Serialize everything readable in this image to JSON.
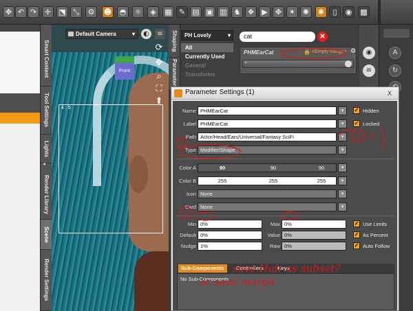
{
  "toolbar": {
    "buttons": [
      {
        "icon": "universal-tool-icon",
        "glyph": "✥"
      },
      {
        "icon": "undo-icon",
        "glyph": "↶"
      },
      {
        "icon": "redo-icon",
        "glyph": "↷"
      },
      {
        "icon": "move-arrows-icon",
        "glyph": "✛"
      },
      {
        "icon": "node-weight-icon",
        "glyph": "⬔"
      },
      {
        "icon": "scale-icon",
        "glyph": "⤡"
      },
      {
        "icon": "joint-editor-icon",
        "glyph": "⚙"
      },
      {
        "icon": "figure-tool-icon",
        "glyph": "☻"
      },
      {
        "icon": "geometry-editor-icon",
        "glyph": "◓"
      },
      {
        "icon": "region-navigator-icon",
        "glyph": "☼"
      },
      {
        "icon": "surface-selection-icon",
        "glyph": "◈"
      },
      {
        "icon": "render-settings-icon",
        "glyph": "▦"
      },
      {
        "icon": "spot-render-icon",
        "glyph": "✎"
      },
      {
        "icon": "aux-viewport-icon",
        "glyph": "▤"
      },
      {
        "icon": "content-library-icon",
        "glyph": "▣"
      },
      {
        "icon": "smart-content-icon",
        "glyph": "▥"
      },
      {
        "icon": "pose-icon",
        "glyph": "♞"
      },
      {
        "icon": "morph-icon",
        "glyph": "❖"
      },
      {
        "icon": "timeline-icon",
        "glyph": "▶"
      },
      {
        "icon": "puppeteer-icon",
        "glyph": "✥"
      },
      {
        "icon": "dform-icon",
        "glyph": "✶"
      },
      {
        "icon": "render-icon",
        "glyph": "✺"
      },
      {
        "icon": "spider-icon",
        "glyph": "✱"
      },
      {
        "icon": "file-icon",
        "glyph": "▯"
      },
      {
        "icon": "camera-icon",
        "glyph": "◉"
      },
      {
        "icon": "render-camera-icon",
        "glyph": "▩"
      }
    ]
  },
  "left_tabs": [
    "Smart Content",
    "Tool Settings",
    "Lights",
    "Render Library",
    "Scene",
    "Render Settings"
  ],
  "viewport": {
    "camera": "Default Camera",
    "cube_label": "Front",
    "frame_label": "4 : 5"
  },
  "params_pane": {
    "vtabs": [
      "Shaping",
      "Parameters"
    ],
    "prop_select": "PH Lovely",
    "prop_items": [
      "All",
      "Currently Used",
      "General",
      "Transforms"
    ],
    "search_value": "cat",
    "param_name": "PHMEarCat",
    "empty_range": "<Empty Range>",
    "slider_sign": "-"
  },
  "dialog": {
    "title": "Parameter Settings (1)",
    "close": "X",
    "fields": {
      "name_label": "Name",
      "name_value": "PHMEarCat",
      "label_label": "Label",
      "label_value": "PHMEarCat",
      "path_label": "Path",
      "path_value": "Actor/Head/Ears/Universal/Fantasy SciFi",
      "type_label": "Type",
      "type_value": "Modifier/Shape",
      "color_a_label": "Color A",
      "color_a": [
        "90",
        "90",
        "90"
      ],
      "color_b_label": "Color B",
      "color_b": [
        "255",
        "255",
        "255"
      ],
      "icon_label": "Icon",
      "icon_value": "None",
      "card_label": "Card",
      "card_value": "None",
      "min_label": "Min",
      "min_value": "0%",
      "max_label": "Max",
      "max_value": "0%",
      "default_label": "Default",
      "default_value": "0%",
      "value_label": "Value",
      "value_value": "0%",
      "nudge_label": "Nudge",
      "nudge_value": "1%",
      "raw_label": "Raw",
      "raw_value": "0%"
    },
    "checks": {
      "hidden": "Hidden",
      "locked": "Locked",
      "use_limits": "Use Limits",
      "as_percent": "As Percent",
      "auto_follow": "Auto Follow"
    },
    "sub_tabs": [
      "Sub-Components",
      "Controllers",
      "Keys"
    ],
    "sub_empty": "No Sub-Components"
  },
  "annotations": {
    "mark_1": "1",
    "mark_2": "2",
    "question": "?",
    "mark_3": "3",
    "note_line1": "save Hair as subset?",
    "note_line2": "or save morph"
  },
  "colors": {
    "accent": "#e88a1c",
    "annotation": "#d81a1a"
  }
}
